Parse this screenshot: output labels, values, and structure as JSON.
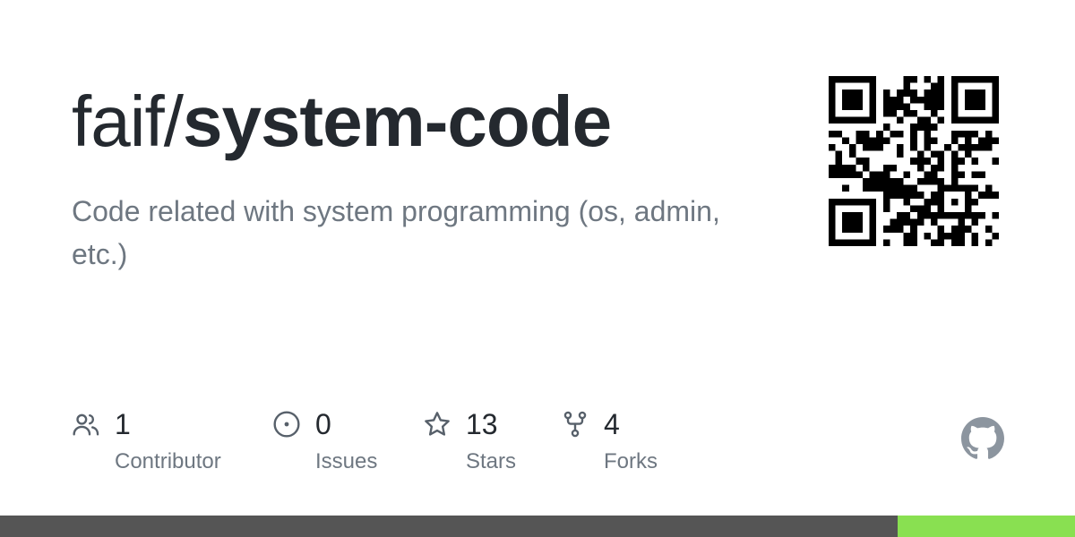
{
  "repo": {
    "owner": "faif/",
    "name": "system-code",
    "description": "Code related with system programming (os, admin, etc.)"
  },
  "stats": [
    {
      "key": "contributors",
      "value": "1",
      "label": "Contributor",
      "icon": "people-icon"
    },
    {
      "key": "issues",
      "value": "0",
      "label": "Issues",
      "icon": "issue-opened-icon"
    },
    {
      "key": "stars",
      "value": "13",
      "label": "Stars",
      "icon": "star-icon"
    },
    {
      "key": "forks",
      "value": "4",
      "label": "Forks",
      "icon": "repo-forked-icon"
    }
  ],
  "language_bar": [
    {
      "color": "#555555",
      "share": 0.835
    },
    {
      "color": "#89e051",
      "share": 0.165
    }
  ],
  "colors": {
    "title": "#24292f",
    "muted": "#6e7781",
    "icon": "#57606a",
    "github_logo": "#8c959f"
  }
}
